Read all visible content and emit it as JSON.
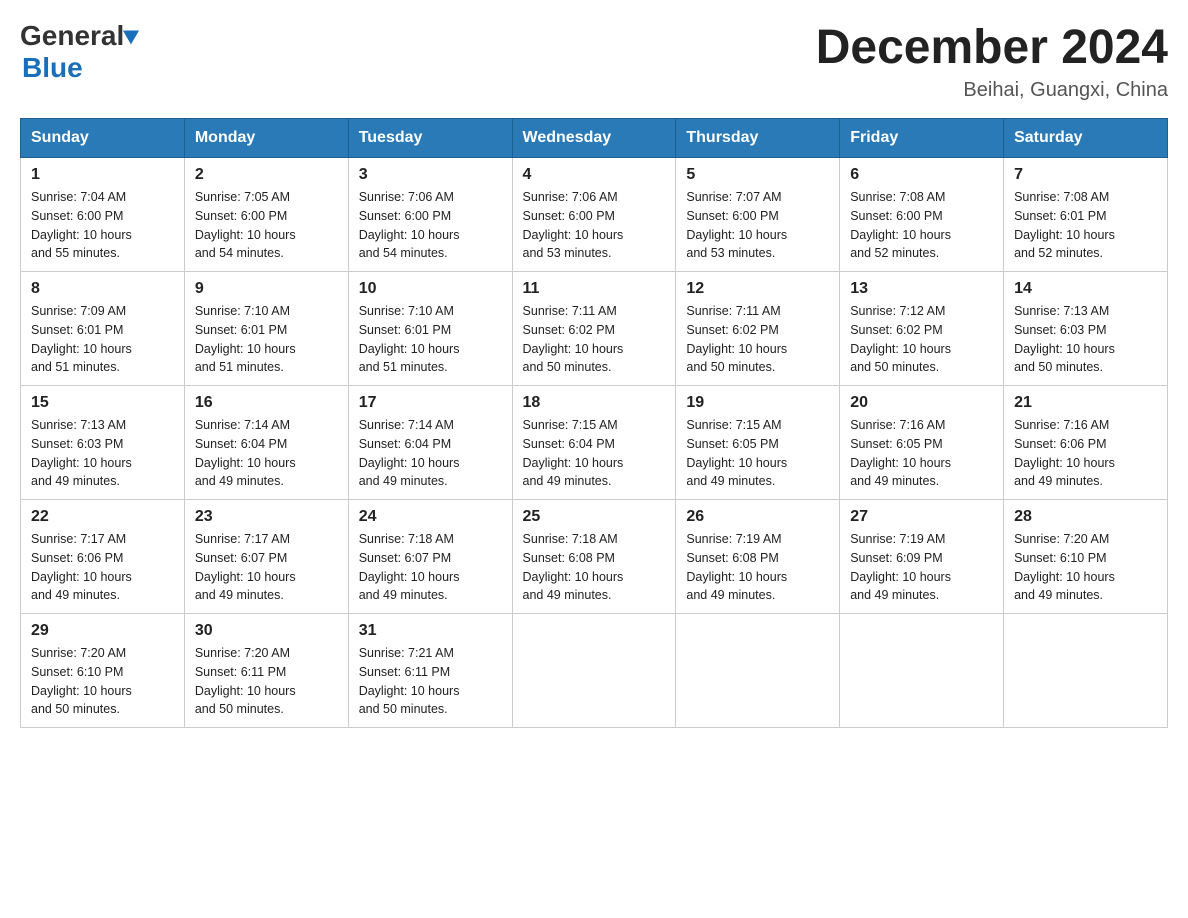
{
  "header": {
    "logo_general": "General",
    "logo_blue": "Blue",
    "month_title": "December 2024",
    "location": "Beihai, Guangxi, China"
  },
  "days_of_week": [
    "Sunday",
    "Monday",
    "Tuesday",
    "Wednesday",
    "Thursday",
    "Friday",
    "Saturday"
  ],
  "weeks": [
    [
      {
        "day": "1",
        "sunrise": "7:04 AM",
        "sunset": "6:00 PM",
        "daylight": "10 hours and 55 minutes."
      },
      {
        "day": "2",
        "sunrise": "7:05 AM",
        "sunset": "6:00 PM",
        "daylight": "10 hours and 54 minutes."
      },
      {
        "day": "3",
        "sunrise": "7:06 AM",
        "sunset": "6:00 PM",
        "daylight": "10 hours and 54 minutes."
      },
      {
        "day": "4",
        "sunrise": "7:06 AM",
        "sunset": "6:00 PM",
        "daylight": "10 hours and 53 minutes."
      },
      {
        "day": "5",
        "sunrise": "7:07 AM",
        "sunset": "6:00 PM",
        "daylight": "10 hours and 53 minutes."
      },
      {
        "day": "6",
        "sunrise": "7:08 AM",
        "sunset": "6:00 PM",
        "daylight": "10 hours and 52 minutes."
      },
      {
        "day": "7",
        "sunrise": "7:08 AM",
        "sunset": "6:01 PM",
        "daylight": "10 hours and 52 minutes."
      }
    ],
    [
      {
        "day": "8",
        "sunrise": "7:09 AM",
        "sunset": "6:01 PM",
        "daylight": "10 hours and 51 minutes."
      },
      {
        "day": "9",
        "sunrise": "7:10 AM",
        "sunset": "6:01 PM",
        "daylight": "10 hours and 51 minutes."
      },
      {
        "day": "10",
        "sunrise": "7:10 AM",
        "sunset": "6:01 PM",
        "daylight": "10 hours and 51 minutes."
      },
      {
        "day": "11",
        "sunrise": "7:11 AM",
        "sunset": "6:02 PM",
        "daylight": "10 hours and 50 minutes."
      },
      {
        "day": "12",
        "sunrise": "7:11 AM",
        "sunset": "6:02 PM",
        "daylight": "10 hours and 50 minutes."
      },
      {
        "day": "13",
        "sunrise": "7:12 AM",
        "sunset": "6:02 PM",
        "daylight": "10 hours and 50 minutes."
      },
      {
        "day": "14",
        "sunrise": "7:13 AM",
        "sunset": "6:03 PM",
        "daylight": "10 hours and 50 minutes."
      }
    ],
    [
      {
        "day": "15",
        "sunrise": "7:13 AM",
        "sunset": "6:03 PM",
        "daylight": "10 hours and 49 minutes."
      },
      {
        "day": "16",
        "sunrise": "7:14 AM",
        "sunset": "6:04 PM",
        "daylight": "10 hours and 49 minutes."
      },
      {
        "day": "17",
        "sunrise": "7:14 AM",
        "sunset": "6:04 PM",
        "daylight": "10 hours and 49 minutes."
      },
      {
        "day": "18",
        "sunrise": "7:15 AM",
        "sunset": "6:04 PM",
        "daylight": "10 hours and 49 minutes."
      },
      {
        "day": "19",
        "sunrise": "7:15 AM",
        "sunset": "6:05 PM",
        "daylight": "10 hours and 49 minutes."
      },
      {
        "day": "20",
        "sunrise": "7:16 AM",
        "sunset": "6:05 PM",
        "daylight": "10 hours and 49 minutes."
      },
      {
        "day": "21",
        "sunrise": "7:16 AM",
        "sunset": "6:06 PM",
        "daylight": "10 hours and 49 minutes."
      }
    ],
    [
      {
        "day": "22",
        "sunrise": "7:17 AM",
        "sunset": "6:06 PM",
        "daylight": "10 hours and 49 minutes."
      },
      {
        "day": "23",
        "sunrise": "7:17 AM",
        "sunset": "6:07 PM",
        "daylight": "10 hours and 49 minutes."
      },
      {
        "day": "24",
        "sunrise": "7:18 AM",
        "sunset": "6:07 PM",
        "daylight": "10 hours and 49 minutes."
      },
      {
        "day": "25",
        "sunrise": "7:18 AM",
        "sunset": "6:08 PM",
        "daylight": "10 hours and 49 minutes."
      },
      {
        "day": "26",
        "sunrise": "7:19 AM",
        "sunset": "6:08 PM",
        "daylight": "10 hours and 49 minutes."
      },
      {
        "day": "27",
        "sunrise": "7:19 AM",
        "sunset": "6:09 PM",
        "daylight": "10 hours and 49 minutes."
      },
      {
        "day": "28",
        "sunrise": "7:20 AM",
        "sunset": "6:10 PM",
        "daylight": "10 hours and 49 minutes."
      }
    ],
    [
      {
        "day": "29",
        "sunrise": "7:20 AM",
        "sunset": "6:10 PM",
        "daylight": "10 hours and 50 minutes."
      },
      {
        "day": "30",
        "sunrise": "7:20 AM",
        "sunset": "6:11 PM",
        "daylight": "10 hours and 50 minutes."
      },
      {
        "day": "31",
        "sunrise": "7:21 AM",
        "sunset": "6:11 PM",
        "daylight": "10 hours and 50 minutes."
      },
      null,
      null,
      null,
      null
    ]
  ],
  "labels": {
    "sunrise": "Sunrise:",
    "sunset": "Sunset:",
    "daylight": "Daylight:"
  }
}
